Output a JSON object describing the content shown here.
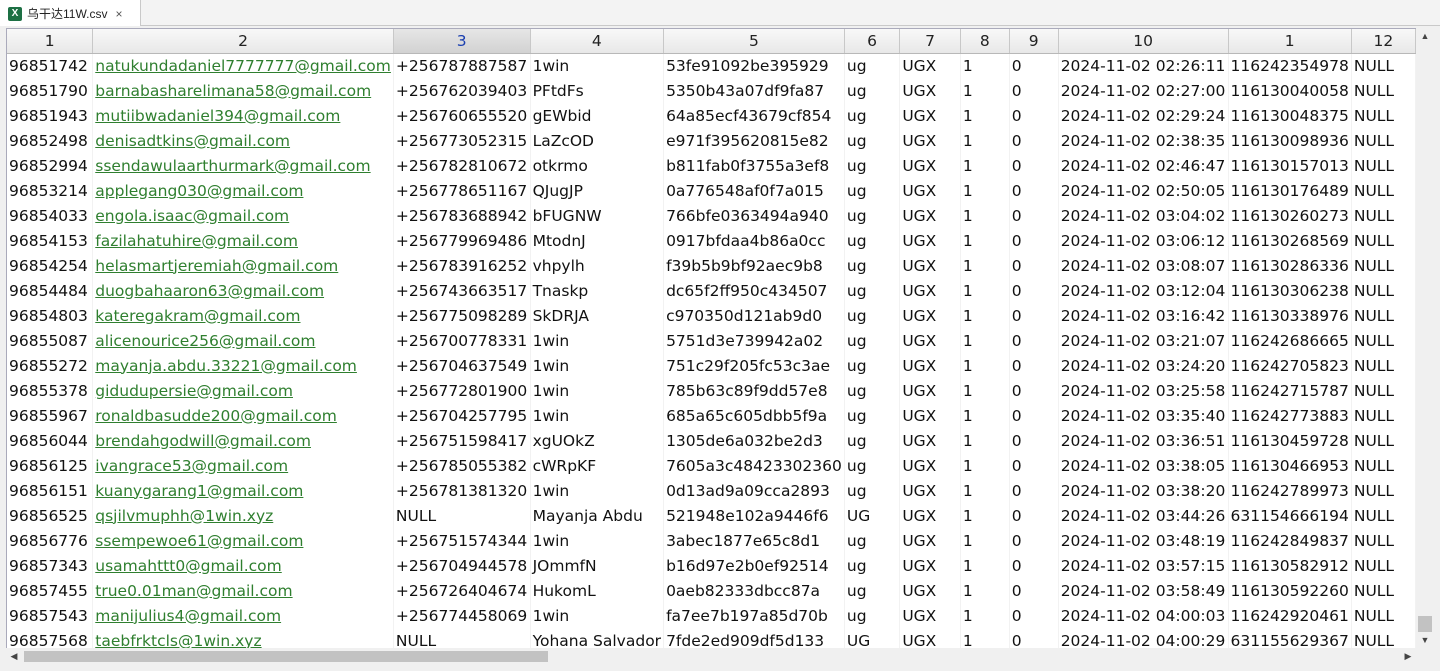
{
  "tab": {
    "title": "乌干达11W.csv",
    "icon": "excel-icon",
    "icon_glyph": "X",
    "close_glyph": "×"
  },
  "scroll": {
    "up": "▲",
    "down": "▼",
    "left": "◀",
    "right": "▶"
  },
  "columns": [
    "1",
    "2",
    "3",
    "4",
    "5",
    "6",
    "7",
    "8",
    "9",
    "10",
    "1",
    "12"
  ],
  "selected_column_index": 2,
  "rows": [
    [
      "96851742",
      "natukundadaniel7777777@gmail.com",
      "+256787887587",
      "1win",
      "53fe91092be395929",
      "ug",
      "UGX",
      "1",
      "0",
      "2024-11-02 02:26:11",
      "116242354978",
      "NULL"
    ],
    [
      "96851790",
      "barnabasharelimana58@gmail.com",
      "+256762039403",
      "PFtdFs",
      "5350b43a07df9fa87",
      "ug",
      "UGX",
      "1",
      "0",
      "2024-11-02 02:27:00",
      "116130040058",
      "NULL"
    ],
    [
      "96851943",
      "mutiibwadaniel394@gmail.com",
      "+256760655520",
      "gEWbid",
      "64a85ecf43679cf854",
      "ug",
      "UGX",
      "1",
      "0",
      "2024-11-02 02:29:24",
      "116130048375",
      "NULL"
    ],
    [
      "96852498",
      "denisadtkins@gmail.com",
      "+256773052315",
      "LaZcOD",
      "e971f395620815e82",
      "ug",
      "UGX",
      "1",
      "0",
      "2024-11-02 02:38:35",
      "116130098936",
      "NULL"
    ],
    [
      "96852994",
      "ssendawulaarthurmark@gmail.com",
      "+256782810672",
      "otkrmo",
      "b811fab0f3755a3ef8",
      "ug",
      "UGX",
      "1",
      "0",
      "2024-11-02 02:46:47",
      "116130157013",
      "NULL"
    ],
    [
      "96853214",
      "applegang030@gmail.com",
      "+256778651167",
      "QJugJP",
      "0a776548af0f7a015",
      "ug",
      "UGX",
      "1",
      "0",
      "2024-11-02 02:50:05",
      "116130176489",
      "NULL"
    ],
    [
      "96854033",
      "engola.isaac@gmail.com",
      "+256783688942",
      "bFUGNW",
      "766bfe0363494a940",
      "ug",
      "UGX",
      "1",
      "0",
      "2024-11-02 03:04:02",
      "116130260273",
      "NULL"
    ],
    [
      "96854153",
      "fazilahatuhire@gmail.com",
      "+256779969486",
      "MtodnJ",
      "0917bfdaa4b86a0cc",
      "ug",
      "UGX",
      "1",
      "0",
      "2024-11-02 03:06:12",
      "116130268569",
      "NULL"
    ],
    [
      "96854254",
      "helasmartjeremiah@gmail.com",
      "+256783916252",
      "vhpylh",
      "f39b5b9bf92aec9b8",
      "ug",
      "UGX",
      "1",
      "0",
      "2024-11-02 03:08:07",
      "116130286336",
      "NULL"
    ],
    [
      "96854484",
      "duogbahaaron63@gmail.com",
      "+256743663517",
      "Tnaskp",
      "dc65f2ff950c434507",
      "ug",
      "UGX",
      "1",
      "0",
      "2024-11-02 03:12:04",
      "116130306238",
      "NULL"
    ],
    [
      "96854803",
      "kateregakram@gmail.com",
      "+256775098289",
      "SkDRJA",
      "c970350d121ab9d0",
      "ug",
      "UGX",
      "1",
      "0",
      "2024-11-02 03:16:42",
      "116130338976",
      "NULL"
    ],
    [
      "96855087",
      "alicenourice256@gmail.com",
      "+256700778331",
      "1win",
      "5751d3e739942a02",
      "ug",
      "UGX",
      "1",
      "0",
      "2024-11-02 03:21:07",
      "116242686665",
      "NULL"
    ],
    [
      "96855272",
      "mayanja.abdu.33221@gmail.com",
      "+256704637549",
      "1win",
      "751c29f205fc53c3ae",
      "ug",
      "UGX",
      "1",
      "0",
      "2024-11-02 03:24:20",
      "116242705823",
      "NULL"
    ],
    [
      "96855378",
      "gidudupersie@gmail.com",
      "+256772801900",
      "1win",
      "785b63c89f9dd57e8",
      "ug",
      "UGX",
      "1",
      "0",
      "2024-11-02 03:25:58",
      "116242715787",
      "NULL"
    ],
    [
      "96855967",
      "ronaldbasudde200@gmail.com",
      "+256704257795",
      "1win",
      "685a65c605dbb5f9a",
      "ug",
      "UGX",
      "1",
      "0",
      "2024-11-02 03:35:40",
      "116242773883",
      "NULL"
    ],
    [
      "96856044",
      "brendahgodwill@gmail.com",
      "+256751598417",
      "xgUOkZ",
      "1305de6a032be2d3",
      "ug",
      "UGX",
      "1",
      "0",
      "2024-11-02 03:36:51",
      "116130459728",
      "NULL"
    ],
    [
      "96856125",
      "ivangrace53@gmail.com",
      "+256785055382",
      "cWRpKF",
      "7605a3c48423302360",
      "ug",
      "UGX",
      "1",
      "0",
      "2024-11-02 03:38:05",
      "116130466953",
      "NULL"
    ],
    [
      "96856151",
      "kuanygarang1@gmail.com",
      "+256781381320",
      "1win",
      "0d13ad9a09cca2893",
      "ug",
      "UGX",
      "1",
      "0",
      "2024-11-02 03:38:20",
      "116242789973",
      "NULL"
    ],
    [
      "96856525",
      "qsjilvmuphh@1win.xyz",
      "NULL",
      "Mayanja Abdu",
      "521948e102a9446f6",
      "UG",
      "UGX",
      "1",
      "0",
      "2024-11-02 03:44:26",
      "631154666194",
      "NULL"
    ],
    [
      "96856776",
      "ssempewoe61@gmail.com",
      "+256751574344",
      "1win",
      "3abec1877e65c8d1",
      "ug",
      "UGX",
      "1",
      "0",
      "2024-11-02 03:48:19",
      "116242849837",
      "NULL"
    ],
    [
      "96857343",
      "usamahttt0@gmail.com",
      "+256704944578",
      "JOmmfN",
      "b16d97e2b0ef92514",
      "ug",
      "UGX",
      "1",
      "0",
      "2024-11-02 03:57:15",
      "116130582912",
      "NULL"
    ],
    [
      "96857455",
      "true0.01man@gmail.com",
      "+256726404674",
      "HukomL",
      "0aeb82333dbcc87a",
      "ug",
      "UGX",
      "1",
      "0",
      "2024-11-02 03:58:49",
      "116130592260",
      "NULL"
    ],
    [
      "96857543",
      "manijulius4@gmail.com",
      "+256774458069",
      "1win",
      "fa7ee7b197a85d70b",
      "ug",
      "UGX",
      "1",
      "0",
      "2024-11-02 04:00:03",
      "116242920461",
      "NULL"
    ],
    [
      "96857568",
      "taebfrktcls@1win.xyz",
      "NULL",
      "Yohana Salvador",
      "7fde2ed909df5d133",
      "UG",
      "UGX",
      "1",
      "0",
      "2024-11-02 04:00:29",
      "631155629367",
      "NULL"
    ]
  ]
}
